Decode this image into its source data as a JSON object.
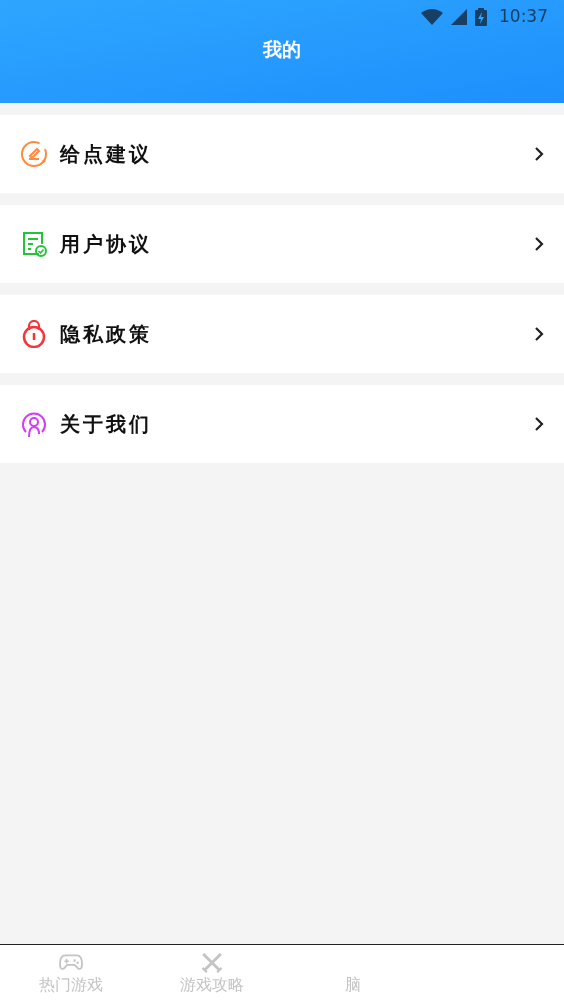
{
  "status_bar": {
    "time": "10:37"
  },
  "header": {
    "title": "我的"
  },
  "menu": [
    {
      "label": "给点建议",
      "kind": "feedback",
      "color": "#ff8a3d"
    },
    {
      "label": "用户协议",
      "kind": "agreement",
      "color": "#22c43a"
    },
    {
      "label": "隐私政策",
      "kind": "privacy",
      "color": "#f5353a"
    },
    {
      "label": "关于我们",
      "kind": "about",
      "color": "#d63cf5"
    }
  ],
  "tab_bar": [
    {
      "label": "热门游戏",
      "kind": "gamepad",
      "selected": false
    },
    {
      "label": "游戏攻略",
      "kind": "swords",
      "selected": false
    },
    {
      "label": "脑",
      "kind": "none",
      "selected": false
    }
  ]
}
